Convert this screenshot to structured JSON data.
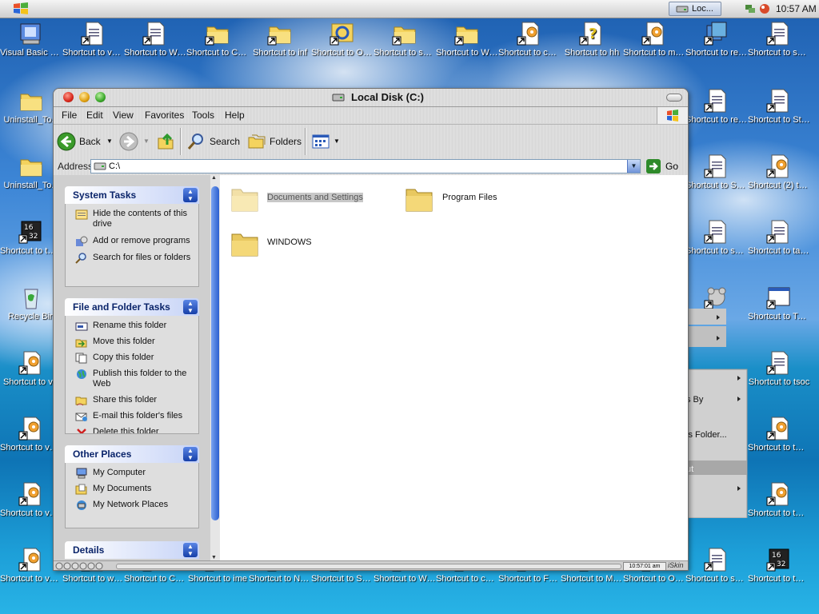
{
  "taskbar": {
    "task_label": "Loc...",
    "clock": "10:57 AM"
  },
  "desktop": {
    "icons": [
      {
        "label": "Visual Basic 6.0",
        "kind": "app"
      },
      {
        "label": "Shortcut to vssetup",
        "kind": "shortcut-doc"
      },
      {
        "label": "Shortcut to WMSysPr9.prx",
        "kind": "shortcut-doc"
      },
      {
        "label": "Shortcut to Cursors",
        "kind": "shortcut-folder"
      },
      {
        "label": "Shortcut to inf",
        "kind": "shortcut-folder"
      },
      {
        "label": "Shortcut to Offline W...",
        "kind": "shortcut-sync"
      },
      {
        "label": "Shortcut to security",
        "kind": "shortcut-folder"
      },
      {
        "label": "Shortcut to Web",
        "kind": "shortcut-folder"
      },
      {
        "label": "Shortcut to control",
        "kind": "shortcut-gear"
      },
      {
        "label": "Shortcut to hh",
        "kind": "shortcut-help"
      },
      {
        "label": "Shortcut to msdfmap",
        "kind": "shortcut-gear"
      },
      {
        "label": "Shortcut to regedit",
        "kind": "shortcut-app"
      },
      {
        "label": "Shortcut to setuplog",
        "kind": "shortcut-doc"
      },
      {
        "label": "Uninstall_To...",
        "kind": "folder"
      },
      {
        "label": "Uninstall_To...",
        "kind": "folder"
      },
      {
        "label": "Shortcut to twunk_32",
        "kind": "shortcut-1632"
      },
      {
        "label": "Recycle Bin",
        "kind": "recycle"
      },
      {
        "label": "Shortcut to v...",
        "kind": "shortcut-gear"
      },
      {
        "label": "Shortcut to vbaddin",
        "kind": "shortcut-gear"
      },
      {
        "label": "Shortcut to vminst",
        "kind": "shortcut-gear"
      },
      {
        "label": "Shortcut to vmmreg32.dll",
        "kind": "shortcut-gear"
      },
      {
        "label": "Shortcut to wmsetup",
        "kind": "shortcut-doc"
      },
      {
        "label": "Shortcut to Connecti...",
        "kind": "shortcut-folder"
      },
      {
        "label": "Shortcut to ime",
        "kind": "shortcut-folder"
      },
      {
        "label": "Shortcut to Network...",
        "kind": "shortcut-folder"
      },
      {
        "label": "Shortcut to SchCache",
        "kind": "shortcut-folder"
      },
      {
        "label": "Shortcut to WBEM",
        "kind": "shortcut-folder"
      },
      {
        "label": "Shortcut to comsetup",
        "kind": "shortcut-folder"
      },
      {
        "label": "Shortcut to FRONTPG",
        "kind": "shortcut-folder"
      },
      {
        "label": "Shortcut to MedCtrOC",
        "kind": "shortcut-folder"
      },
      {
        "label": "Shortcut to ODBCINST",
        "kind": "shortcut-folder"
      },
      {
        "label": "Shortcut to setuperr",
        "kind": "shortcut-doc"
      },
      {
        "label": "Shortcut to twunk_16",
        "kind": "shortcut-1632"
      },
      {
        "label": "Shortcut to regopt",
        "kind": "shortcut-doc"
      },
      {
        "label": "Shortcut to Sti_Trace",
        "kind": "shortcut-doc"
      },
      {
        "label": "Shortcut to SchedLgU",
        "kind": "shortcut-doc"
      },
      {
        "label": "Shortcut (2) to system",
        "kind": "shortcut-gear"
      },
      {
        "label": "Shortcut to sessmgr.setup",
        "kind": "shortcut-doc"
      },
      {
        "label": "Shortcut to tabletoc",
        "kind": "shortcut-doc"
      },
      {
        "label": "Shortcut to TASKMAN",
        "kind": "shortcut-window"
      },
      {
        "label": "Shortcut to tsoc",
        "kind": "shortcut-doc"
      },
      {
        "label": "Shortcut to twain.dll",
        "kind": "shortcut-gear"
      },
      {
        "label": "Shortcut to twain_32.dll",
        "kind": "shortcut-gear"
      },
      {
        "label": "...ug",
        "kind": "shortcut-bear"
      }
    ],
    "bg_menu_items": [
      "s By",
      "is Folder...",
      "ut"
    ]
  },
  "window": {
    "title": "Local Disk (C:)",
    "menu": [
      "File",
      "Edit",
      "View",
      "Favorites",
      "Tools",
      "Help"
    ],
    "toolbar": {
      "back": "Back",
      "search": "Search",
      "folders": "Folders"
    },
    "address": {
      "label": "Address",
      "value": "C:\\",
      "go": "Go"
    },
    "panels": {
      "system": {
        "title": "System Tasks",
        "items": [
          "Hide the contents of this drive",
          "Add or remove programs",
          "Search for files or folders"
        ]
      },
      "file": {
        "title": "File and Folder Tasks",
        "items": [
          "Rename this folder",
          "Move this folder",
          "Copy this folder",
          "Publish this folder to the Web",
          "Share this folder",
          "E-mail this folder's files",
          "Delete this folder"
        ]
      },
      "other": {
        "title": "Other Places",
        "items": [
          "My Computer",
          "My Documents",
          "My Network Places"
        ]
      },
      "details": {
        "title": "Details"
      }
    },
    "folders": [
      "Documents and Settings",
      "Program Files",
      "WINDOWS"
    ],
    "statusbar": {
      "time": "10:57:01 am",
      "skin": "iSkin"
    }
  },
  "colors": {
    "panel_header": "#0a246a",
    "chevron": "#2b5fcf",
    "folder": "#f4d35e"
  }
}
